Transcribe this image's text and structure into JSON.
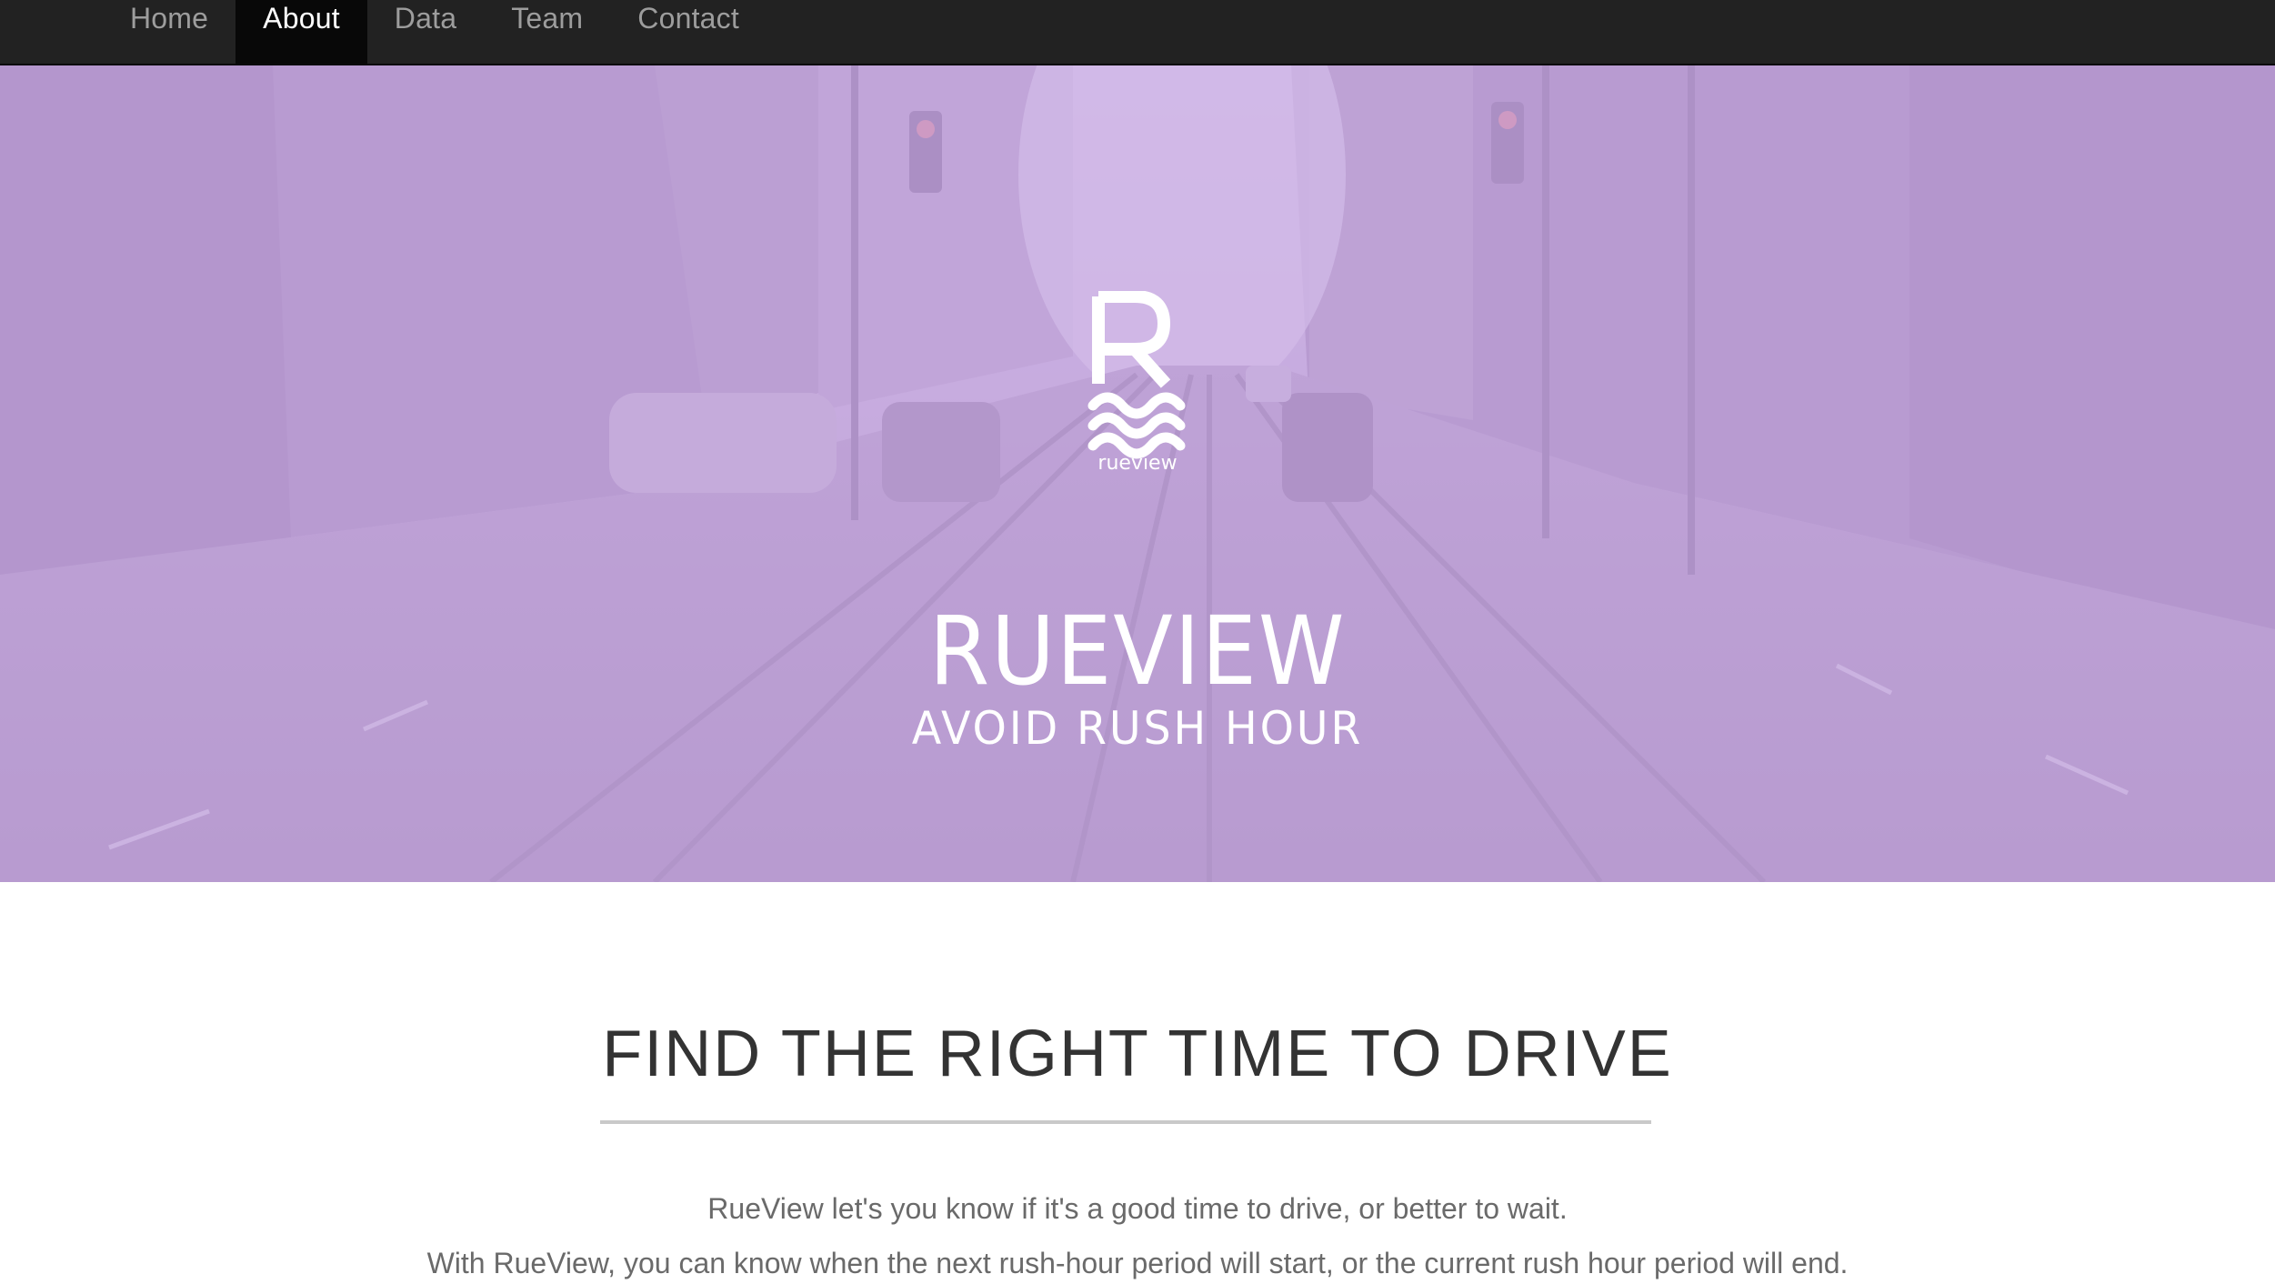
{
  "nav": {
    "items": [
      {
        "label": "Home",
        "active": false
      },
      {
        "label": "About",
        "active": true
      },
      {
        "label": "Data",
        "active": false
      },
      {
        "label": "Team",
        "active": false
      },
      {
        "label": "Contact",
        "active": false
      }
    ]
  },
  "hero": {
    "logo_letter": "R",
    "logo_text": "rueview",
    "title": "RUEVIEW",
    "subtitle": "AVOID RUSH HOUR",
    "background": "city-street-photo",
    "tint_color": "#c4a8e0"
  },
  "content": {
    "heading": "FIND THE RIGHT TIME TO DRIVE",
    "paragraphs": [
      "RueView let's you know if it's a good time to drive, or better to wait.",
      "With RueView, you can know when the next rush-hour period will start, or the current rush hour period will end."
    ]
  },
  "colors": {
    "navbar_bg": "#222222",
    "navbar_active_bg": "#080808",
    "nav_text": "#9d9d9d",
    "heading_text": "#333333",
    "body_text": "#6a6a6a"
  }
}
